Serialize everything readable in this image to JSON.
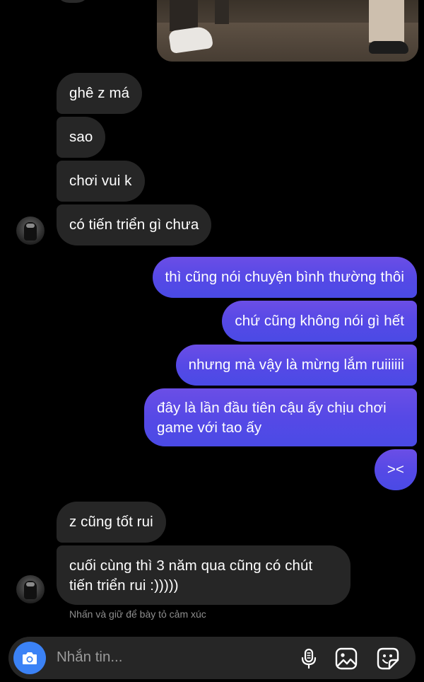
{
  "thread": {
    "messages": [
      {
        "side": "in",
        "text": "ghê z má"
      },
      {
        "side": "in",
        "text": "sao"
      },
      {
        "side": "in",
        "text": "chơi vui k"
      },
      {
        "side": "in",
        "text": "có tiến triển gì chưa"
      },
      {
        "side": "out",
        "text": "thì cũng nói chuyện bình thường thôi"
      },
      {
        "side": "out",
        "text": "chứ cũng không nói gì hết"
      },
      {
        "side": "out",
        "text": "nhưng mà vậy là mừng lắm ruiiiiii"
      },
      {
        "side": "out",
        "line1": "đây là lần đầu tiên cậu ấy chịu chơi",
        "line2": "game với tao ấy"
      },
      {
        "side": "out",
        "text": "><"
      },
      {
        "side": "in",
        "text": "z cũng tốt rui"
      },
      {
        "side": "in",
        "line1": "cuối cùng thì 3 năm qua cũng có chút",
        "line2": "tiến triển rui :)))))"
      }
    ],
    "reaction_hint": "Nhấn và giữ để bày tỏ cảm xúc"
  },
  "composer": {
    "placeholder": "Nhắn tin...",
    "icons": [
      "camera-icon",
      "microphone-icon",
      "gallery-icon",
      "sticker-icon"
    ],
    "camera_color": "#3b82f6"
  },
  "colors": {
    "incoming_bubble": "#262626",
    "outgoing_bubble_top": "#6b4ee6",
    "outgoing_bubble_bottom": "#4a4ae5",
    "background": "#000000"
  }
}
